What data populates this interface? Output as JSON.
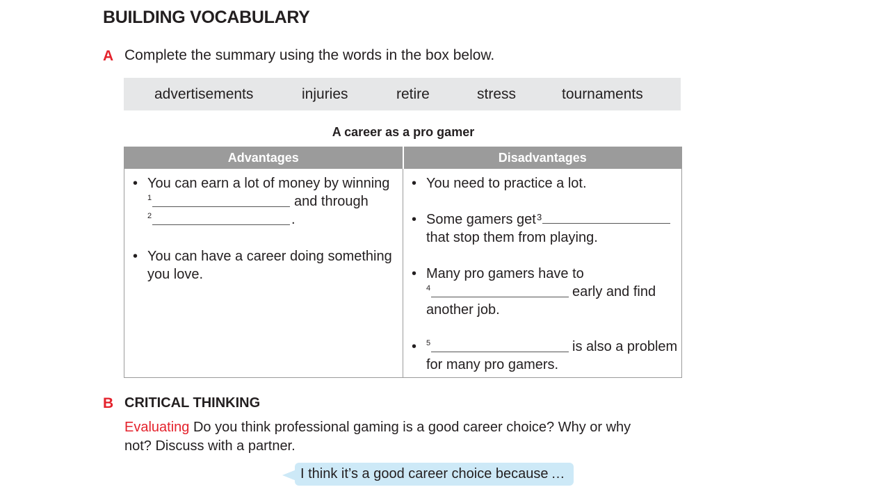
{
  "heading": "BUILDING VOCABULARY",
  "exercise_a": {
    "letter": "A",
    "instruction": "Complete the summary using the words in the box below.",
    "word_box": [
      "advertisements",
      "injuries",
      "retire",
      "stress",
      "tournaments"
    ],
    "table_title": "A career as a pro gamer",
    "columns": [
      "Advantages",
      "Disadvantages"
    ],
    "advantages": {
      "item1_line1": "You can earn a lot of money by winning",
      "blank1_num": "1",
      "item1_and": "and through",
      "blank2_num": "2",
      "item1_end": ".",
      "item2_line1": "You can have a career doing something",
      "item2_line2": "you love."
    },
    "disadvantages": {
      "item1": "You need to practice a lot.",
      "item2_line1": "Some gamers get",
      "blank3_num": "3",
      "item2_line2": "that stop them from playing.",
      "item3_line1": "Many pro gamers have to",
      "blank4_num": "4",
      "item3_after": "early and find",
      "item3_line3": "another job.",
      "blank5_num": "5",
      "item4_after": "is also a problem",
      "item4_line2": "for many pro gamers."
    }
  },
  "exercise_b": {
    "letter": "B",
    "title": "CRITICAL THINKING",
    "label": "Evaluating",
    "question_line1": "Do you think professional gaming is a good career choice? Why or why",
    "question_line2": "not? Discuss with a partner.",
    "speech_bubble": "I think it’s a good career choice because …"
  },
  "colors": {
    "accent_red": "#e4222c",
    "word_box_bg": "#e6e7e8",
    "table_header_bg": "#9b9b9b",
    "bubble_bg": "#cde9f7"
  }
}
